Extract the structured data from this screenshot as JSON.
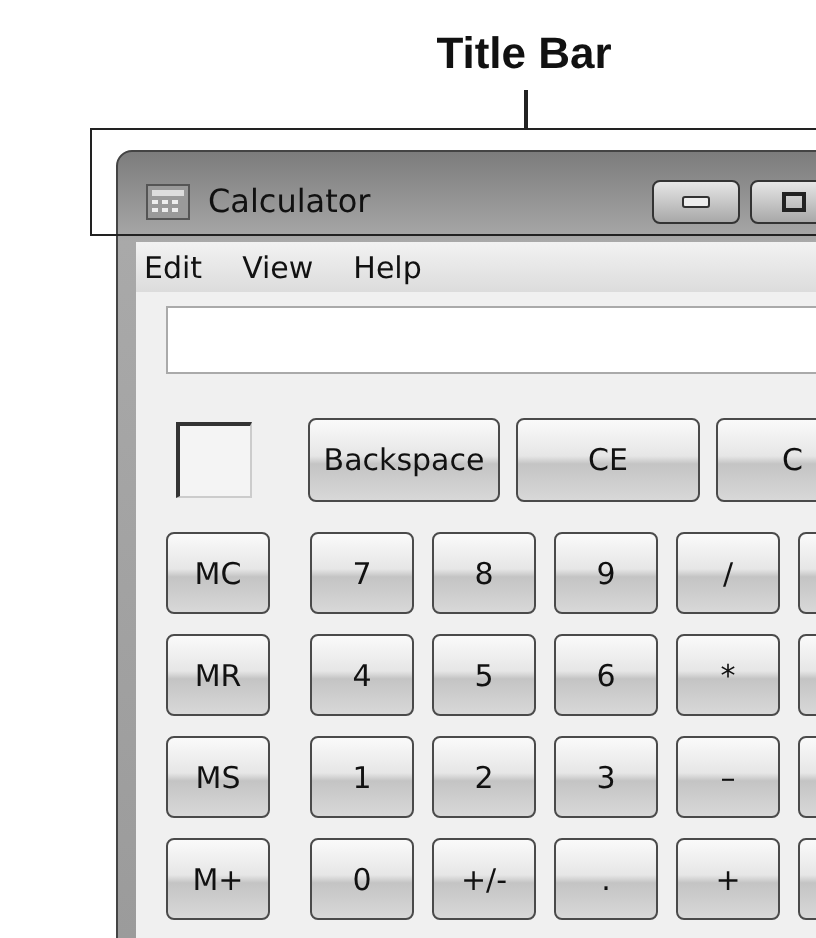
{
  "annotation": {
    "label": "Title Bar"
  },
  "window": {
    "title": "Calculator"
  },
  "menu": [
    "Edit",
    "View",
    "Help"
  ],
  "top_keys": [
    "Backspace",
    "CE",
    "C"
  ],
  "memory_keys": [
    "MC",
    "MR",
    "MS",
    "M+"
  ],
  "keypad": [
    [
      "7",
      "8",
      "9",
      "/"
    ],
    [
      "4",
      "5",
      "6",
      "*"
    ],
    [
      "1",
      "2",
      "3",
      "–"
    ],
    [
      "0",
      "+/-",
      ".",
      "+"
    ]
  ]
}
